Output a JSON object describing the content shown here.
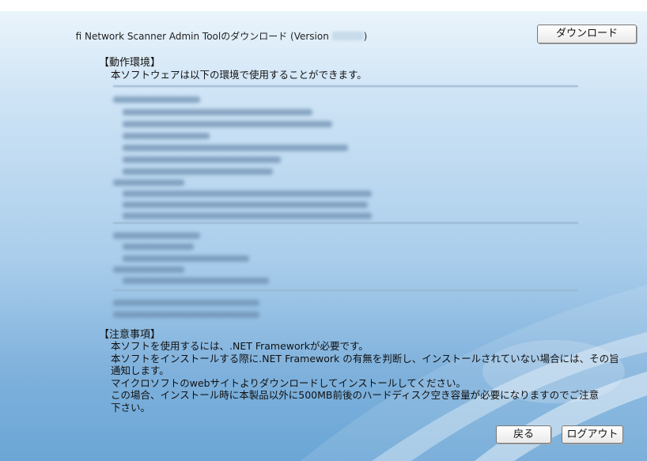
{
  "header": {
    "title_prefix": "fi Network Scanner Admin Toolのダウンロード (Version",
    "title_suffix": ")",
    "download_label": "ダウンロード"
  },
  "environment": {
    "heading": "【動作環境】",
    "description": "本ソフトウェアは以下の環境で使用することができます。"
  },
  "notes": {
    "heading": "【注意事項】",
    "lines": [
      "本ソフトを使用するには、.NET Frameworkが必要です。",
      "本ソフトをインストールする際に.NET Framework の有無を判断し、インストールされていない場合には、その旨",
      "通知します。",
      "マイクロソフトのwebサイトよりダウンロードしてインストールしてください。",
      "この場合、インストール時に本製品以外に500MB前後のハードディスク空き容量が必要になりますのでご注意",
      "下さい。"
    ]
  },
  "footer": {
    "back_label": "戻る",
    "logout_label": "ログアウト"
  },
  "colors": {
    "background_top": "#eaf4fb",
    "background_bottom": "#6aa6d6",
    "button_border": "#777777"
  }
}
